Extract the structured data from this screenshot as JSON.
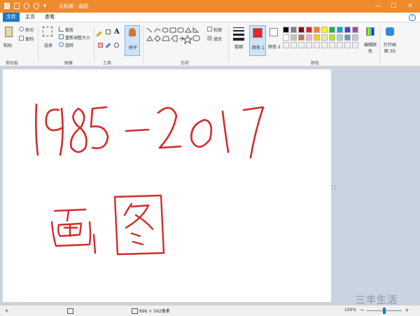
{
  "window": {
    "title": "无标题 - 画图",
    "controls": {
      "minimize": "—",
      "maximize": "☐",
      "close": "✕"
    }
  },
  "menu": {
    "tabs": [
      {
        "label": "文件",
        "active": true
      },
      {
        "label": "主页",
        "active": false
      },
      {
        "label": "查看",
        "active": false
      }
    ],
    "help": "?"
  },
  "ribbon": {
    "clipboard": {
      "paste": "粘贴",
      "cut": "剪切",
      "copy": "复制",
      "label": "剪贴板"
    },
    "image": {
      "select": "选择",
      "crop": "裁剪",
      "resize": "重新调整大小",
      "rotate": "旋转",
      "label": "图像"
    },
    "tools": {
      "label": "工具"
    },
    "brushes": {
      "label": "刷子"
    },
    "shapes": {
      "outline": "轮廓",
      "fill": "填充",
      "label": "形状"
    },
    "size": {
      "label": "粗细"
    },
    "color1": {
      "label": "颜色 1",
      "color": "#e8262c"
    },
    "color2": {
      "label": "颜色 2",
      "color": "#ffffff"
    },
    "edit_colors": "编辑颜色",
    "paint3d": "打开画图 3D",
    "colors_label": "颜色",
    "palette": [
      "#000000",
      "#7f7f7f",
      "#880015",
      "#ed1c24",
      "#ff7f27",
      "#fff200",
      "#22b14c",
      "#00a2e8",
      "#3f48cc",
      "#a349a4",
      "#ffffff",
      "#c3c3c3",
      "#b97a57",
      "#ffaec9",
      "#ffc90e",
      "#efe4b0",
      "#b5e61d",
      "#99d9ea",
      "#7092be",
      "#c8bfe7"
    ]
  },
  "canvas": {
    "ink_color": "#d22b2b",
    "handwriting": {
      "line1": "1985-2017",
      "line2": "画图"
    }
  },
  "status": {
    "dimensions": "896 × 562像素",
    "zoom": "100%"
  },
  "watermark": "三丰生活"
}
